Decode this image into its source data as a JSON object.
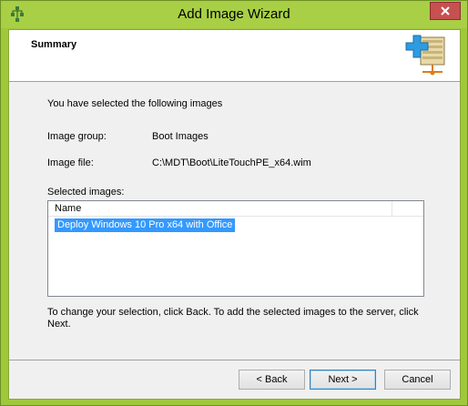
{
  "window": {
    "title": "Add Image Wizard",
    "close_glyph": "✕",
    "frame_color": "#9fc83a"
  },
  "header": {
    "title": "Summary"
  },
  "summary": {
    "intro": "You have selected the following images",
    "image_group_label": "Image group:",
    "image_group_value": "Boot Images",
    "image_file_label": "Image file:",
    "image_file_value": "C:\\MDT\\Boot\\LiteTouchPE_x64.wim",
    "selected_images_label": "Selected images:",
    "columns": [
      "Name"
    ],
    "rows": [
      "Deploy Windows 10 Pro x64 with Office"
    ],
    "instruction": "To change your selection, click Back. To add the selected images to the server, click Next."
  },
  "buttons": {
    "back": "< Back",
    "next": "Next >",
    "cancel": "Cancel"
  },
  "icons": {
    "app": "wds-tree-icon",
    "header": "add-image-icon",
    "close": "close-icon"
  }
}
